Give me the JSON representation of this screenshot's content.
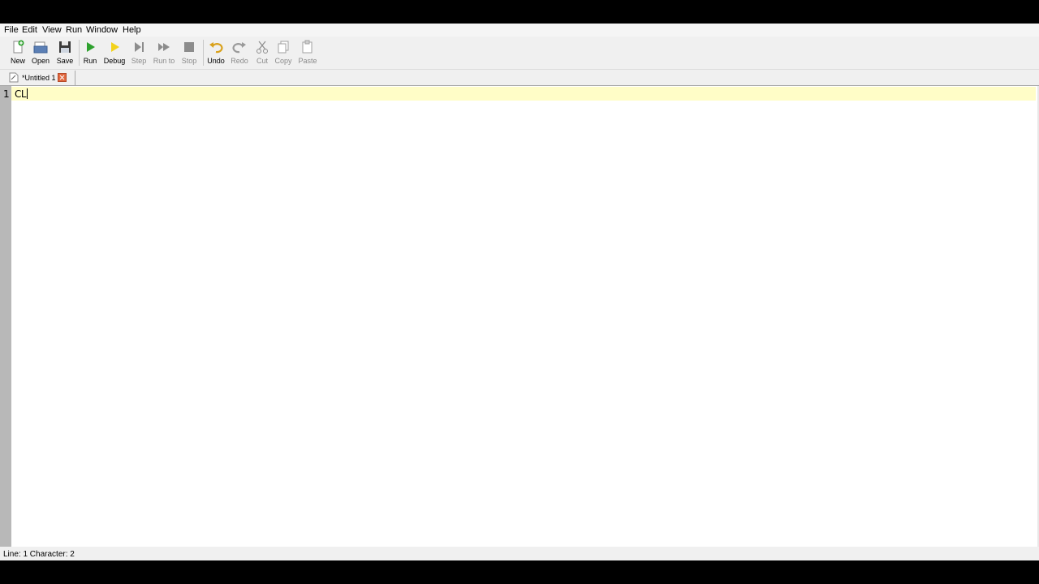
{
  "menu": [
    "File",
    "Edit",
    "View",
    "Run",
    "Window",
    "Help"
  ],
  "toolbar": {
    "new": "New",
    "open": "Open",
    "save": "Save",
    "run": "Run",
    "debug": "Debug",
    "step": "Step",
    "run_to": "Run to",
    "stop": "Stop",
    "undo": "Undo",
    "redo": "Redo",
    "cut": "Cut",
    "copy": "Copy",
    "paste": "Paste"
  },
  "tab": {
    "title": "*Untitled 1"
  },
  "editor": {
    "line_number": "1",
    "line_text": "CL"
  },
  "status": {
    "text": "Line: 1 Character: 2"
  },
  "colors": {
    "current_line": "#fffdc7",
    "run_green": "#2ea12e",
    "debug_yellow": "#f2d21b",
    "undo_orange": "#d9a11c",
    "close_red": "#e0683f"
  }
}
